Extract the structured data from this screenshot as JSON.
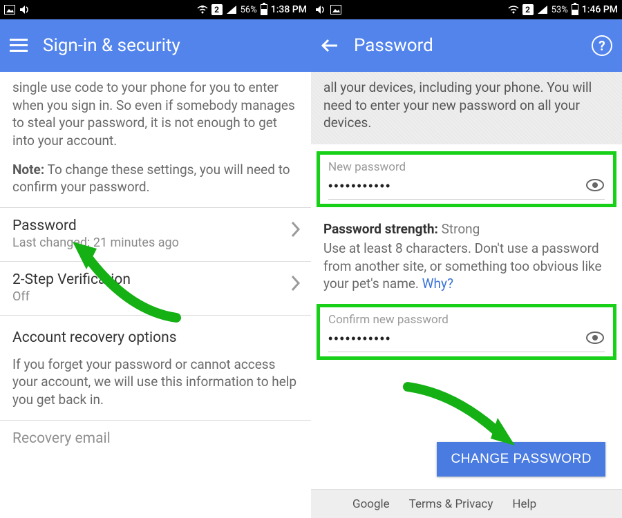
{
  "left": {
    "status": {
      "sim": "2",
      "battery_text": "56%",
      "battery_pct": 56,
      "time": "1:38 PM"
    },
    "appbar": {
      "title": "Sign-in & security"
    },
    "intro_partial": "enter when you sign in. So even if somebody manages to steal your password, it is not enough to get into your account.",
    "note_label": "Note:",
    "note_text": " To change these settings, you will need to confirm your password.",
    "rows": {
      "password": {
        "title": "Password",
        "sub": "Last changed: 21 minutes ago"
      },
      "twostep": {
        "title": "2-Step Verification",
        "sub": "Off"
      }
    },
    "recovery": {
      "title": "Account recovery options",
      "text": "If you forget your password or cannot access your account, we will use this information to help you get back in."
    },
    "cutoff_row": "Recovery email"
  },
  "right": {
    "status": {
      "sim": "2",
      "battery_text": "53%",
      "battery_pct": 53,
      "time": "1:46 PM"
    },
    "appbar": {
      "title": "Password"
    },
    "top_text": "all your devices, including your phone. You will need to enter your new password on all your devices.",
    "fields": {
      "new": {
        "label": "New password",
        "value": "•••••••••••"
      },
      "confirm": {
        "label": "Confirm new password",
        "value": "•••••••••••"
      }
    },
    "strength": {
      "label": "Password strength:",
      "value": " Strong",
      "help": "Use at least 8 characters. Don't use a password from another site, or something too obvious like your pet's name. ",
      "why": "Why?"
    },
    "change_button": "CHANGE PASSWORD",
    "footer": {
      "google": "Google",
      "terms": "Terms & Privacy",
      "help": "Help"
    }
  }
}
